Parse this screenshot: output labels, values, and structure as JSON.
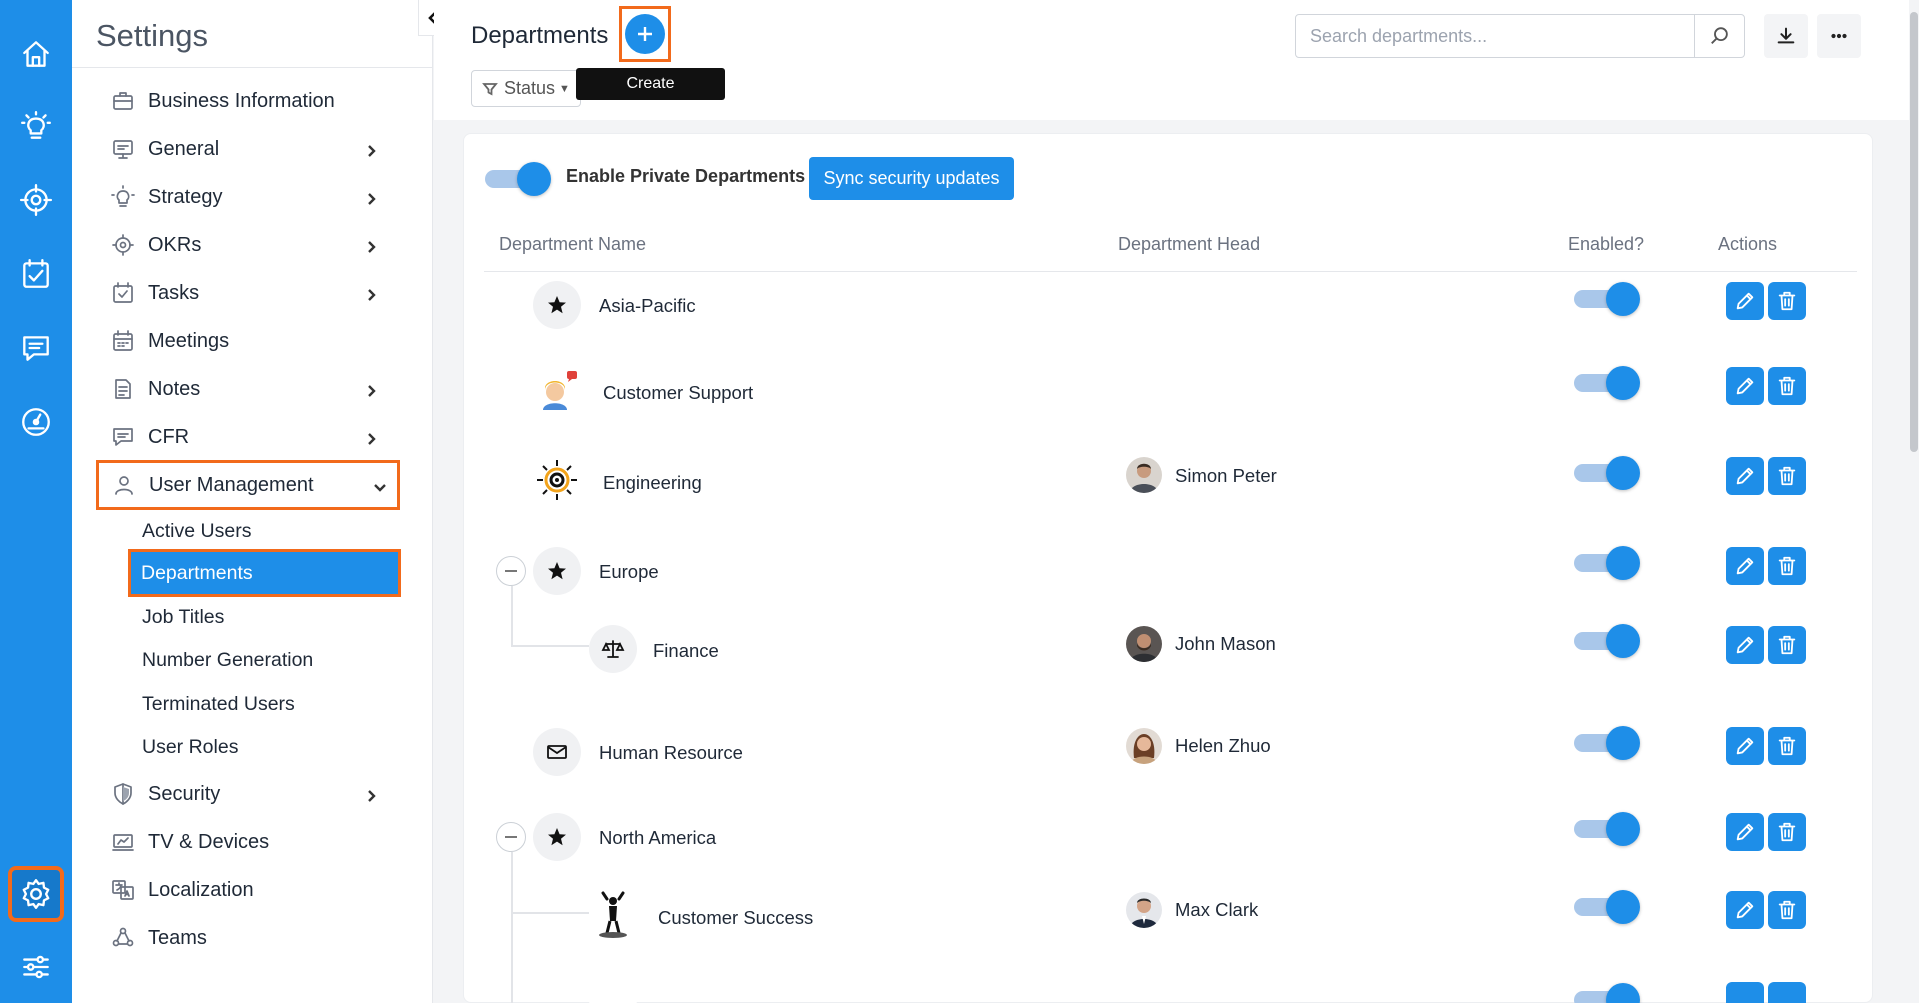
{
  "sidebar": {
    "title": "Settings",
    "items": [
      {
        "label": "Business Information",
        "icon": "briefcase-icon"
      },
      {
        "label": "General",
        "icon": "monitor-icon"
      },
      {
        "label": "Strategy",
        "icon": "lightbulb-icon"
      },
      {
        "label": "OKRs",
        "icon": "target-icon"
      },
      {
        "label": "Tasks",
        "icon": "checkbox-calendar-icon"
      },
      {
        "label": "Meetings",
        "icon": "calendar-icon"
      },
      {
        "label": "Notes",
        "icon": "note-icon"
      },
      {
        "label": "CFR",
        "icon": "chat-icon"
      },
      {
        "label": "User Management",
        "icon": "user-icon"
      },
      {
        "label": "Security",
        "icon": "shield-icon"
      },
      {
        "label": "TV & Devices",
        "icon": "tv-icon"
      },
      {
        "label": "Localization",
        "icon": "translate-icon"
      },
      {
        "label": "Teams",
        "icon": "teams-icon"
      }
    ],
    "user_management_sub": [
      "Active Users",
      "Departments",
      "Job Titles",
      "Number Generation",
      "Terminated Users",
      "User Roles"
    ]
  },
  "header": {
    "title": "Departments",
    "create_tooltip": "Create",
    "status_filter": "Status",
    "search_placeholder": "Search departments..."
  },
  "controls": {
    "enable_private_label": "Enable Private Departments",
    "enable_private_on": true,
    "sync_button": "Sync security updates"
  },
  "table": {
    "columns": [
      "Department Name",
      "Department Head",
      "Enabled?",
      "Actions"
    ],
    "rows": [
      {
        "name": "Asia-Pacific",
        "head": "",
        "enabled": true,
        "icon": "star-icon"
      },
      {
        "name": "Customer Support",
        "head": "",
        "enabled": true,
        "icon": "support-agent-icon"
      },
      {
        "name": "Engineering",
        "head": "Simon Peter",
        "enabled": true,
        "icon": "gear-network-icon"
      },
      {
        "name": "Europe",
        "head": "",
        "enabled": true,
        "icon": "star-icon"
      },
      {
        "name": "Finance",
        "head": "John Mason",
        "enabled": true,
        "icon": "scale-icon"
      },
      {
        "name": "Human Resource",
        "head": "Helen Zhuo",
        "enabled": true,
        "icon": "envelope-icon"
      },
      {
        "name": "North America",
        "head": "",
        "enabled": true,
        "icon": "star-icon"
      },
      {
        "name": "Customer Success",
        "head": "Max Clark",
        "enabled": true,
        "icon": "trophy-person-icon"
      }
    ]
  },
  "colors": {
    "accent": "#1e8ee8",
    "highlight": "#f26a1b"
  }
}
